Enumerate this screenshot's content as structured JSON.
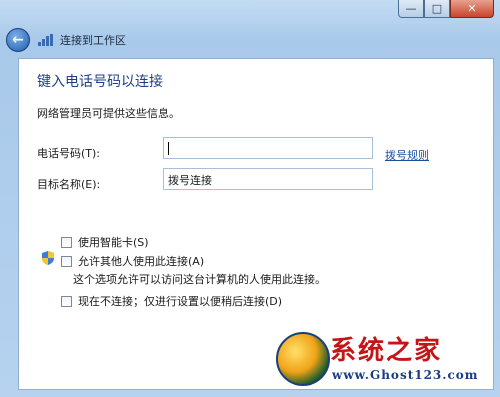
{
  "window": {
    "title": "连接到工作区",
    "caption": {
      "minimize": "—",
      "maximize": "□",
      "close": "✕"
    }
  },
  "page": {
    "heading": "键入电话号码以连接",
    "intro": "网络管理员可提供这些信息。",
    "phone": {
      "label": "电话号码(T):",
      "value": ""
    },
    "dial_rules_link": "拨号规则",
    "destination": {
      "label": "目标名称(E):",
      "value": "拨号连接"
    },
    "smart_card": {
      "label": "使用智能卡(S)",
      "checked": false
    },
    "allow_others": {
      "label": "允许其他人使用此连接(A)",
      "checked": false,
      "note": "这个选项允许可以访问这台计算机的人使用此连接。"
    },
    "connect_later": {
      "label": "现在不连接；仅进行设置以便稍后连接(D)",
      "checked": false
    }
  },
  "watermark": {
    "title": "系统之家",
    "url": "www.Ghost123.com"
  },
  "colors": {
    "heading": "#1e3f86",
    "link": "#1a4fa0",
    "close": "#c7442b",
    "watermark_title": "#c41616"
  }
}
